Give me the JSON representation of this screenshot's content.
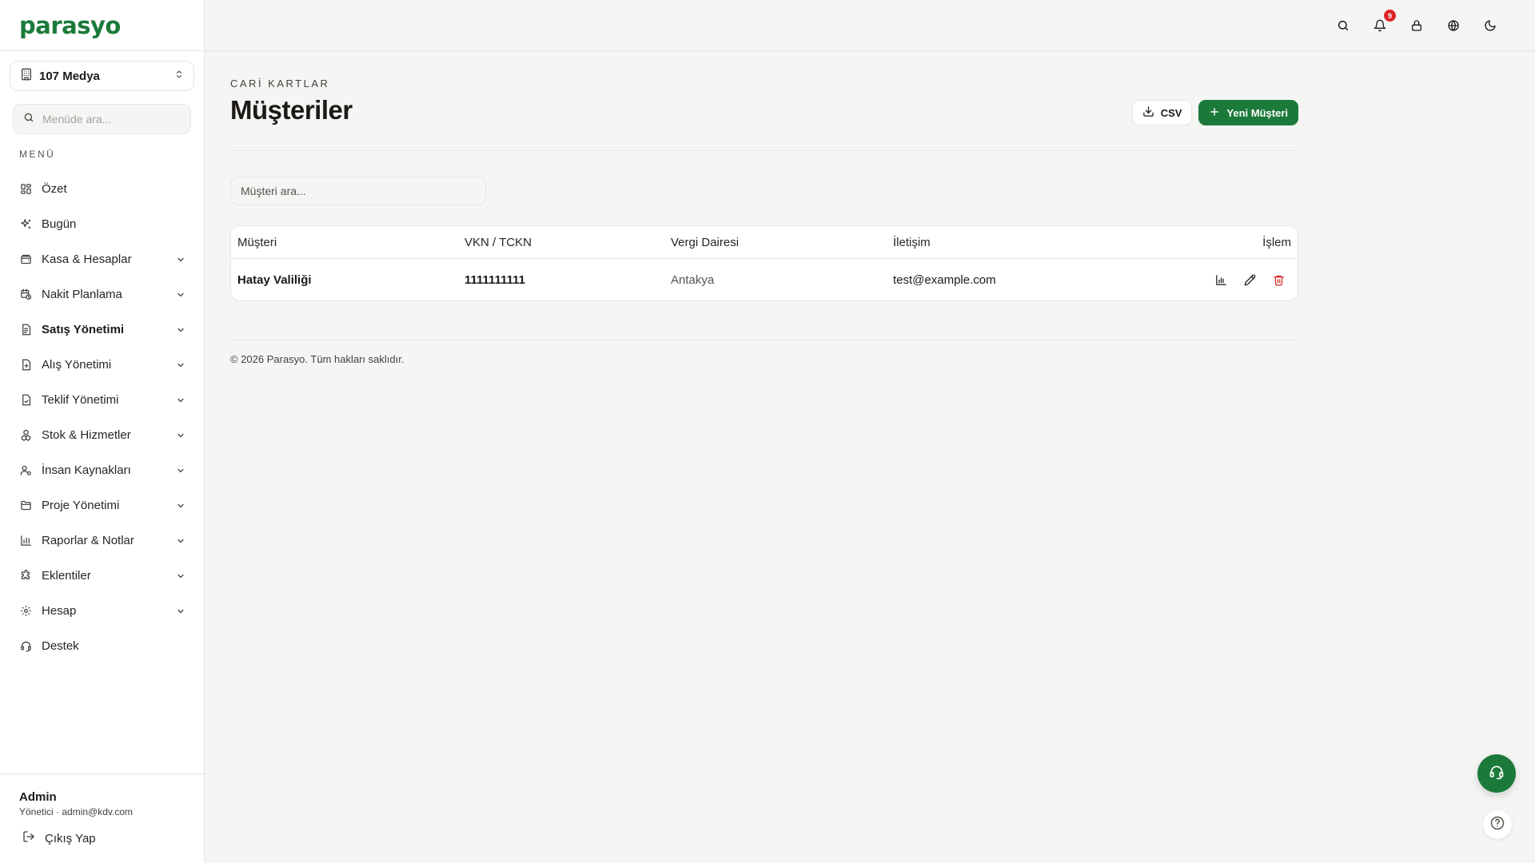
{
  "brand": {
    "logo": "parasyo",
    "accent": "#1b7a3a",
    "danger": "#dc2626"
  },
  "company": {
    "name": "107 Medya"
  },
  "sidebar": {
    "search_placeholder": "Menüde ara...",
    "section_label": "MENÜ",
    "items": [
      {
        "label": "Özet",
        "icon": "grid-icon",
        "has_children": false
      },
      {
        "label": "Bugün",
        "icon": "sparkles-icon",
        "has_children": false
      },
      {
        "label": "Kasa & Hesaplar",
        "icon": "wallet-icon",
        "has_children": true
      },
      {
        "label": "Nakit Planlama",
        "icon": "calendar-clock-icon",
        "has_children": true
      },
      {
        "label": "Satış Yönetimi",
        "icon": "document-icon",
        "has_children": true,
        "active": true
      },
      {
        "label": "Alış Yönetimi",
        "icon": "file-plus-icon",
        "has_children": true
      },
      {
        "label": "Teklif Yönetimi",
        "icon": "file-check-icon",
        "has_children": true
      },
      {
        "label": "Stok & Hizmetler",
        "icon": "boxes-icon",
        "has_children": true
      },
      {
        "label": "İnsan Kaynakları",
        "icon": "user-cog-icon",
        "has_children": true
      },
      {
        "label": "Proje Yönetimi",
        "icon": "folder-icon",
        "has_children": true
      },
      {
        "label": "Raporlar & Notlar",
        "icon": "bar-chart-icon",
        "has_children": true
      },
      {
        "label": "Eklentiler",
        "icon": "puzzle-icon",
        "has_children": true
      },
      {
        "label": "Hesap",
        "icon": "gear-icon",
        "has_children": true
      },
      {
        "label": "Destek",
        "icon": "headset-icon",
        "has_children": false
      }
    ]
  },
  "user": {
    "name": "Admin",
    "subtitle": "Yönetici · admin@kdv.com",
    "logout_label": "Çıkış Yap"
  },
  "topbar": {
    "notification_count": "9"
  },
  "page": {
    "breadcrumb": "CARİ KARTLAR",
    "title": "Müşteriler",
    "csv_label": "CSV",
    "new_label": "Yeni Müşteri",
    "search_placeholder": "Müşteri ara..."
  },
  "table": {
    "headers": [
      "Müşteri",
      "VKN / TCKN",
      "Vergi Dairesi",
      "İletişim",
      "İşlem"
    ],
    "rows": [
      {
        "name": "Hatay Valiliği",
        "vkn": "1111111111",
        "tax_office": "Antakya",
        "contact": "test@example.com"
      }
    ]
  },
  "footer": "© 2026 Parasyo. Tüm hakları saklıdır."
}
